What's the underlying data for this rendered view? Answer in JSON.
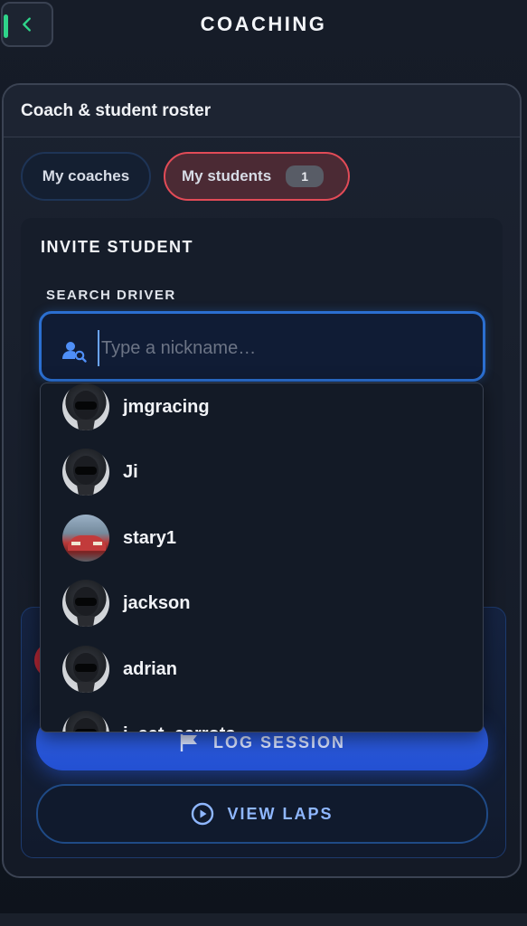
{
  "header": {
    "title": "COACHING",
    "back_icon": "chevron-left-icon"
  },
  "roster": {
    "title": "Coach & student roster",
    "tabs": [
      {
        "label": "My coaches",
        "active": false
      },
      {
        "label": "My students",
        "active": true,
        "count": "1"
      }
    ]
  },
  "invite": {
    "title": "INVITE STUDENT",
    "search_label": "SEARCH DRIVER",
    "search_placeholder": "Type a nickname…",
    "search_value": ""
  },
  "suggestions": [
    {
      "name": "jmgracing",
      "avatar": "helmet"
    },
    {
      "name": "Ji",
      "avatar": "helmet"
    },
    {
      "name": "stary1",
      "avatar": "car"
    },
    {
      "name": "jackson",
      "avatar": "helmet"
    },
    {
      "name": "adrian",
      "avatar": "helmet"
    },
    {
      "name": "i_eat_carrots",
      "avatar": "helmet"
    }
  ],
  "actions": {
    "log_session": "LOG SESSION",
    "view_laps": "VIEW LAPS"
  },
  "colors": {
    "accent_blue": "#2f5fe0",
    "active_tab_border": "#e24b57",
    "back_accent": "#2fd48a"
  }
}
